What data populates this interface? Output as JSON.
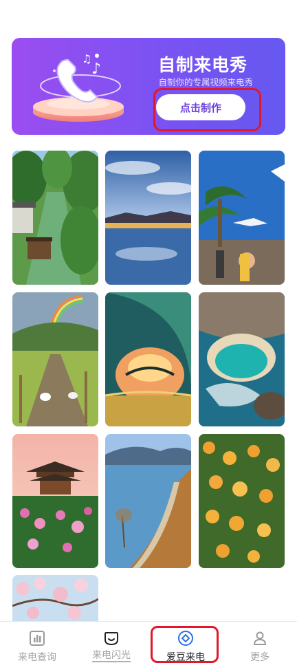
{
  "banner": {
    "title": "自制来电秀",
    "subtitle": "自制你的专属视频来电秀",
    "button_label": "点击制作",
    "gradient": [
      "#9b4df0",
      "#6558f0"
    ]
  },
  "wallpapers": [
    {
      "subject": "canal-village"
    },
    {
      "subject": "lake-sunset-sky"
    },
    {
      "subject": "palm-beach-seagull"
    },
    {
      "subject": "rainbow-field-path"
    },
    {
      "subject": "ocean-wave-sunset"
    },
    {
      "subject": "rocky-coast-pool"
    },
    {
      "subject": "pavilion-peonies"
    },
    {
      "subject": "lakeside-road"
    },
    {
      "subject": "orange-blossoms"
    },
    {
      "subject": "cherry-blossoms"
    }
  ],
  "nav": {
    "items": [
      {
        "label": "来电查询",
        "icon": "bar-chart-icon"
      },
      {
        "label": "来电闪光",
        "icon": "smile-face-icon"
      },
      {
        "label": "爱豆来电",
        "icon": "diamond-circle-icon"
      },
      {
        "label": "更多",
        "icon": "person-icon"
      }
    ],
    "active_index": 2,
    "active_color": "#2a6fe8",
    "inactive_color": "#a3a3a3"
  },
  "highlight_color": "#e0182b"
}
